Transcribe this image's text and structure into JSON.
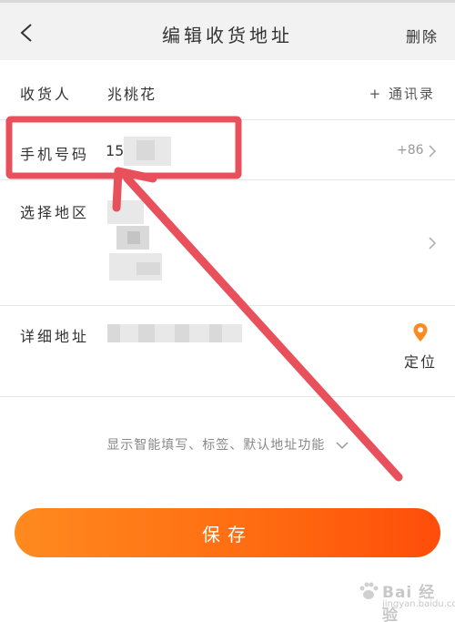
{
  "header": {
    "title": "编辑收货地址",
    "delete_label": "删除"
  },
  "form": {
    "recipient": {
      "label": "收货人",
      "value": "兆桃花",
      "contacts_link": "+ 通讯录"
    },
    "phone": {
      "label": "手机号码",
      "value": "15",
      "country_code": "+86"
    },
    "region": {
      "label": "选择地区"
    },
    "address": {
      "label": "详细地址",
      "locate_label": "定位"
    }
  },
  "hint": "显示智能填写、标签、默认地址功能",
  "save_label": "保存",
  "watermark": {
    "text": "Bai 经验",
    "sub": "jingyan.baidu.com"
  },
  "colors": {
    "accent_orange": "#ff6a10",
    "annotation_red": "#e8505b",
    "location_pin": "#ff8a1f"
  }
}
